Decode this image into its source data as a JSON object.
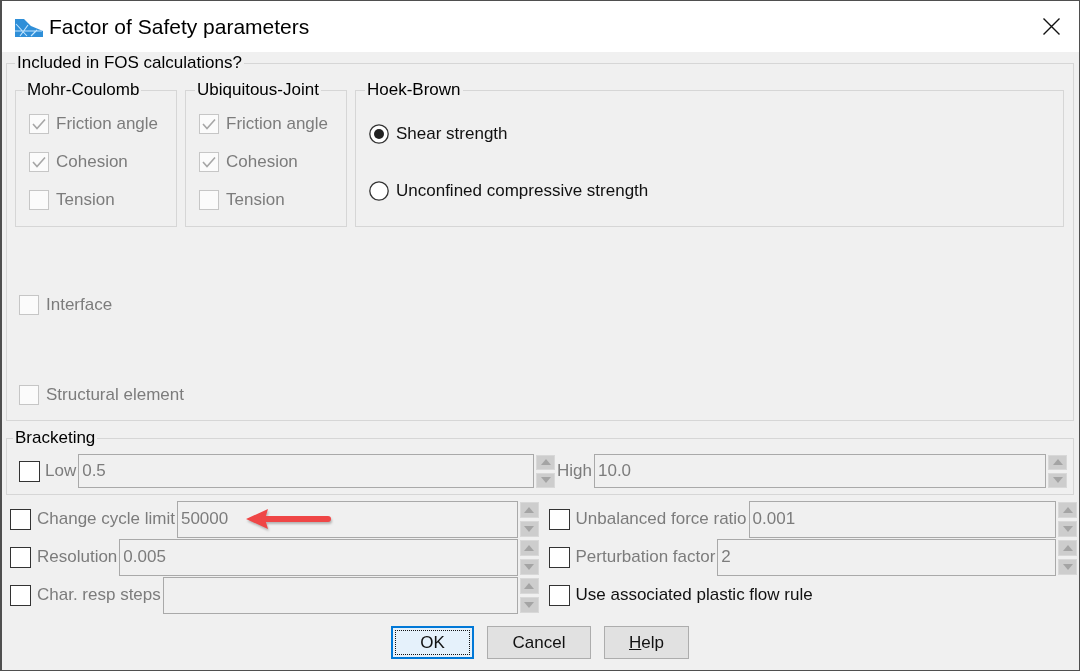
{
  "window": {
    "title": "Factor of Safety parameters"
  },
  "included": {
    "title": "Included in FOS calculations?",
    "groups": [
      {
        "title": "Mohr-Coulomb",
        "kind": "checkboxes",
        "options": [
          {
            "label": "Friction angle",
            "checked": true,
            "disabled": true
          },
          {
            "label": "Cohesion",
            "checked": true,
            "disabled": true
          },
          {
            "label": "Tension",
            "checked": false,
            "disabled": true
          }
        ]
      },
      {
        "title": "Ubiquitous-Joint",
        "kind": "checkboxes",
        "options": [
          {
            "label": "Friction angle",
            "checked": true,
            "disabled": true
          },
          {
            "label": "Cohesion",
            "checked": true,
            "disabled": true
          },
          {
            "label": "Tension",
            "checked": false,
            "disabled": true
          }
        ]
      },
      {
        "title": "Hoek-Brown",
        "kind": "radios",
        "options": [
          {
            "label": "Shear strength",
            "selected": true
          },
          {
            "label": "Unconfined compressive strength",
            "selected": false
          }
        ]
      }
    ],
    "options": [
      {
        "label": "Interface",
        "checked": false,
        "disabled": true
      },
      {
        "label": "Structural element",
        "checked": false,
        "disabled": true
      }
    ]
  },
  "bracketing": {
    "title": "Bracketing",
    "checked": false,
    "fields": [
      {
        "label": "Low",
        "value": "0.5",
        "disabled": true
      },
      {
        "label": "High",
        "value": "10.0",
        "disabled": true
      }
    ]
  },
  "parameters": [
    {
      "kind": "spin",
      "label": "Change cycle limit",
      "checked": false,
      "disabled": true,
      "value": "50000",
      "annotated": true
    },
    {
      "kind": "spin",
      "label": "Unbalanced force ratio",
      "checked": false,
      "disabled": true,
      "value": "0.001",
      "annotated": false
    },
    {
      "kind": "spin",
      "label": "Resolution",
      "checked": false,
      "disabled": true,
      "value": "0.005",
      "annotated": false
    },
    {
      "kind": "spin",
      "label": "Perturbation factor",
      "checked": false,
      "disabled": true,
      "value": "2",
      "annotated": false
    },
    {
      "kind": "spin",
      "label": "Char. resp steps",
      "checked": false,
      "disabled": true,
      "annotated": false
    },
    {
      "kind": "check",
      "label": "Use associated plastic flow rule",
      "checked": false,
      "disabled": false
    }
  ],
  "buttons": [
    {
      "label": "OK",
      "default": true,
      "mnemonic": false
    },
    {
      "label": "Cancel",
      "default": false,
      "mnemonic": false
    },
    {
      "label": "Help",
      "default": false,
      "mnemonic": true
    }
  ]
}
